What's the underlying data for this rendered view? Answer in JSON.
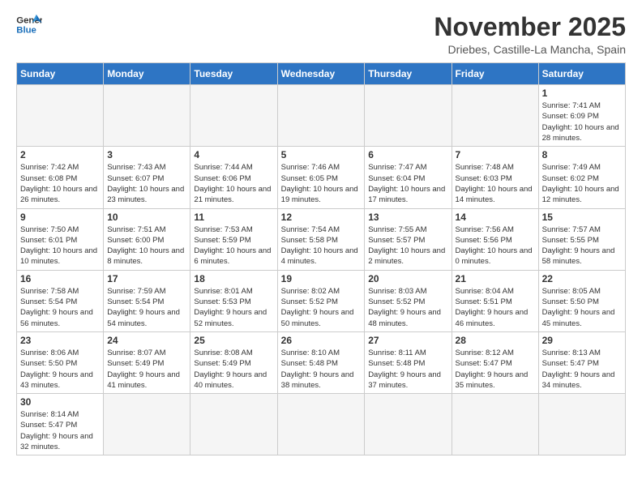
{
  "header": {
    "logo_general": "General",
    "logo_blue": "Blue",
    "month_title": "November 2025",
    "subtitle": "Driebes, Castille-La Mancha, Spain"
  },
  "weekdays": [
    "Sunday",
    "Monday",
    "Tuesday",
    "Wednesday",
    "Thursday",
    "Friday",
    "Saturday"
  ],
  "weeks": [
    [
      {
        "day": null,
        "info": null
      },
      {
        "day": null,
        "info": null
      },
      {
        "day": null,
        "info": null
      },
      {
        "day": null,
        "info": null
      },
      {
        "day": null,
        "info": null
      },
      {
        "day": null,
        "info": null
      },
      {
        "day": "1",
        "info": "Sunrise: 7:41 AM\nSunset: 6:09 PM\nDaylight: 10 hours and 28 minutes."
      }
    ],
    [
      {
        "day": "2",
        "info": "Sunrise: 7:42 AM\nSunset: 6:08 PM\nDaylight: 10 hours and 26 minutes."
      },
      {
        "day": "3",
        "info": "Sunrise: 7:43 AM\nSunset: 6:07 PM\nDaylight: 10 hours and 23 minutes."
      },
      {
        "day": "4",
        "info": "Sunrise: 7:44 AM\nSunset: 6:06 PM\nDaylight: 10 hours and 21 minutes."
      },
      {
        "day": "5",
        "info": "Sunrise: 7:46 AM\nSunset: 6:05 PM\nDaylight: 10 hours and 19 minutes."
      },
      {
        "day": "6",
        "info": "Sunrise: 7:47 AM\nSunset: 6:04 PM\nDaylight: 10 hours and 17 minutes."
      },
      {
        "day": "7",
        "info": "Sunrise: 7:48 AM\nSunset: 6:03 PM\nDaylight: 10 hours and 14 minutes."
      },
      {
        "day": "8",
        "info": "Sunrise: 7:49 AM\nSunset: 6:02 PM\nDaylight: 10 hours and 12 minutes."
      }
    ],
    [
      {
        "day": "9",
        "info": "Sunrise: 7:50 AM\nSunset: 6:01 PM\nDaylight: 10 hours and 10 minutes."
      },
      {
        "day": "10",
        "info": "Sunrise: 7:51 AM\nSunset: 6:00 PM\nDaylight: 10 hours and 8 minutes."
      },
      {
        "day": "11",
        "info": "Sunrise: 7:53 AM\nSunset: 5:59 PM\nDaylight: 10 hours and 6 minutes."
      },
      {
        "day": "12",
        "info": "Sunrise: 7:54 AM\nSunset: 5:58 PM\nDaylight: 10 hours and 4 minutes."
      },
      {
        "day": "13",
        "info": "Sunrise: 7:55 AM\nSunset: 5:57 PM\nDaylight: 10 hours and 2 minutes."
      },
      {
        "day": "14",
        "info": "Sunrise: 7:56 AM\nSunset: 5:56 PM\nDaylight: 10 hours and 0 minutes."
      },
      {
        "day": "15",
        "info": "Sunrise: 7:57 AM\nSunset: 5:55 PM\nDaylight: 9 hours and 58 minutes."
      }
    ],
    [
      {
        "day": "16",
        "info": "Sunrise: 7:58 AM\nSunset: 5:54 PM\nDaylight: 9 hours and 56 minutes."
      },
      {
        "day": "17",
        "info": "Sunrise: 7:59 AM\nSunset: 5:54 PM\nDaylight: 9 hours and 54 minutes."
      },
      {
        "day": "18",
        "info": "Sunrise: 8:01 AM\nSunset: 5:53 PM\nDaylight: 9 hours and 52 minutes."
      },
      {
        "day": "19",
        "info": "Sunrise: 8:02 AM\nSunset: 5:52 PM\nDaylight: 9 hours and 50 minutes."
      },
      {
        "day": "20",
        "info": "Sunrise: 8:03 AM\nSunset: 5:52 PM\nDaylight: 9 hours and 48 minutes."
      },
      {
        "day": "21",
        "info": "Sunrise: 8:04 AM\nSunset: 5:51 PM\nDaylight: 9 hours and 46 minutes."
      },
      {
        "day": "22",
        "info": "Sunrise: 8:05 AM\nSunset: 5:50 PM\nDaylight: 9 hours and 45 minutes."
      }
    ],
    [
      {
        "day": "23",
        "info": "Sunrise: 8:06 AM\nSunset: 5:50 PM\nDaylight: 9 hours and 43 minutes."
      },
      {
        "day": "24",
        "info": "Sunrise: 8:07 AM\nSunset: 5:49 PM\nDaylight: 9 hours and 41 minutes."
      },
      {
        "day": "25",
        "info": "Sunrise: 8:08 AM\nSunset: 5:49 PM\nDaylight: 9 hours and 40 minutes."
      },
      {
        "day": "26",
        "info": "Sunrise: 8:10 AM\nSunset: 5:48 PM\nDaylight: 9 hours and 38 minutes."
      },
      {
        "day": "27",
        "info": "Sunrise: 8:11 AM\nSunset: 5:48 PM\nDaylight: 9 hours and 37 minutes."
      },
      {
        "day": "28",
        "info": "Sunrise: 8:12 AM\nSunset: 5:47 PM\nDaylight: 9 hours and 35 minutes."
      },
      {
        "day": "29",
        "info": "Sunrise: 8:13 AM\nSunset: 5:47 PM\nDaylight: 9 hours and 34 minutes."
      }
    ],
    [
      {
        "day": "30",
        "info": "Sunrise: 8:14 AM\nSunset: 5:47 PM\nDaylight: 9 hours and 32 minutes."
      },
      {
        "day": null,
        "info": null
      },
      {
        "day": null,
        "info": null
      },
      {
        "day": null,
        "info": null
      },
      {
        "day": null,
        "info": null
      },
      {
        "day": null,
        "info": null
      },
      {
        "day": null,
        "info": null
      }
    ]
  ]
}
